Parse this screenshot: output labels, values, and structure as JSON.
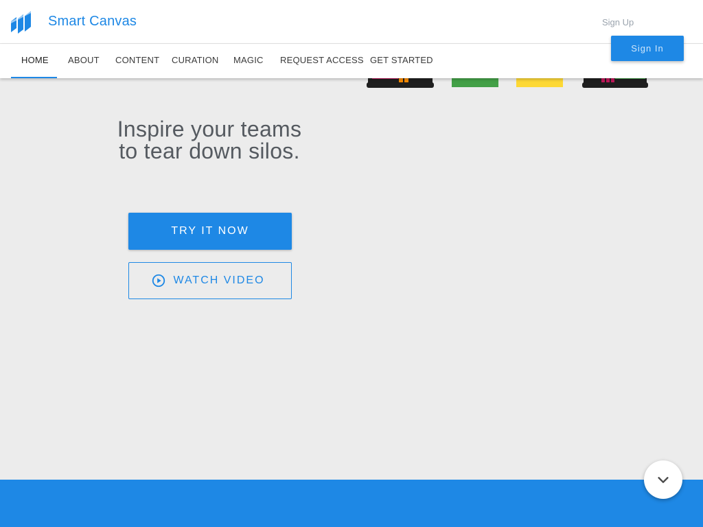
{
  "header": {
    "brand_name": "Smart Canvas",
    "signup_label": "Sign Up",
    "signin_label": "Sign In"
  },
  "nav": {
    "items": [
      {
        "label": "HOME",
        "active": true
      },
      {
        "label": "ABOUT"
      },
      {
        "label": "CONTENT"
      },
      {
        "label": "CURATION"
      },
      {
        "label": "MAGIC"
      },
      {
        "label": "REQUEST ACCESS"
      },
      {
        "label": "GET STARTED"
      }
    ]
  },
  "hero": {
    "title_line1": "Inspire your teams",
    "title_line2": "to tear down silos.",
    "try_label": "TRY IT NOW",
    "video_label": "WATCH VIDEO"
  },
  "icons": {
    "logo": "smart-canvas-logo",
    "play": "play-circle-icon",
    "scroll": "chevron-down-icon"
  },
  "colors": {
    "accent": "#1e88e5",
    "background": "#ececec",
    "text_heading": "#555a60",
    "device_green": "#43a047",
    "device_yellow": "#fdd835",
    "device_magenta": "#c2185b",
    "device_orange": "#fb8c00"
  }
}
